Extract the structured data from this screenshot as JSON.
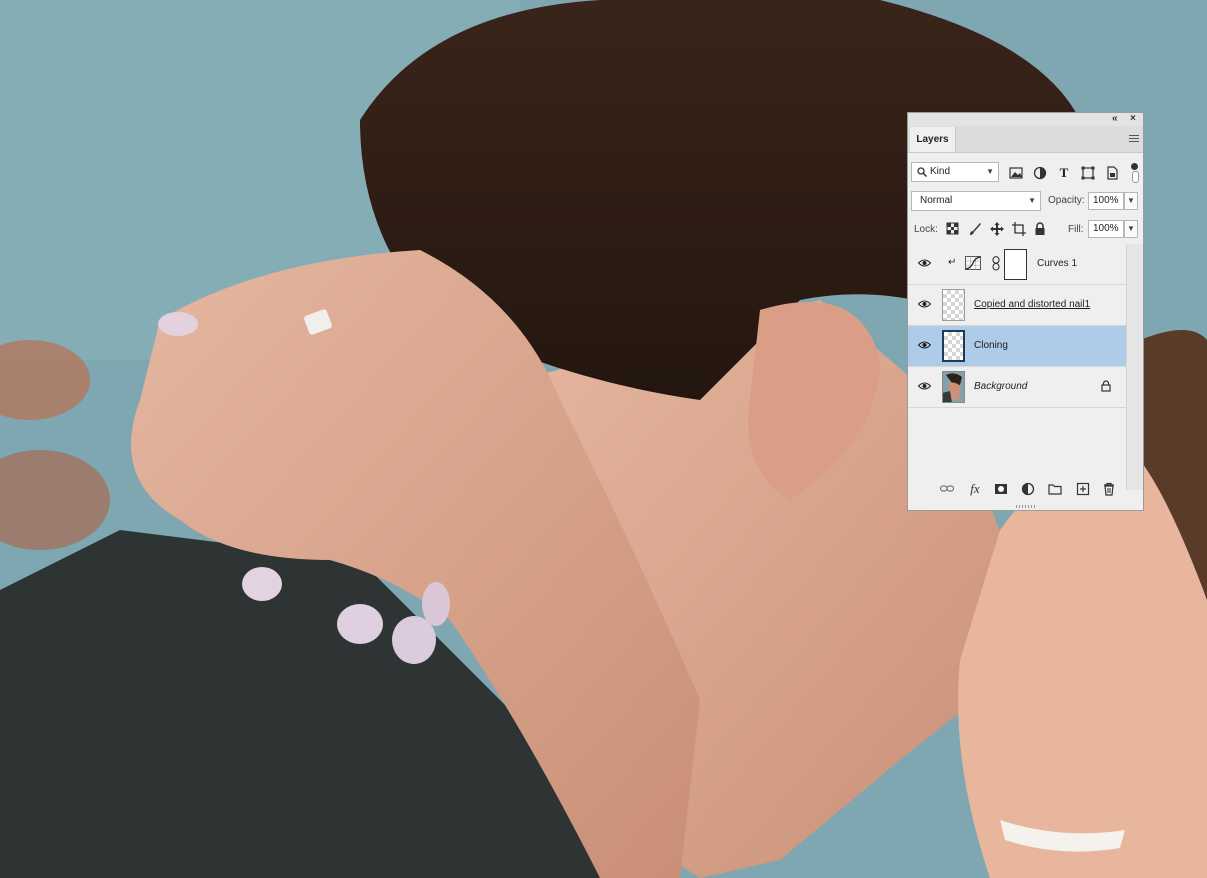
{
  "panel": {
    "title": "Layers",
    "collapse_icon": "double-chevron-left-icon",
    "close_icon": "close-icon",
    "collapse_glyph": "«",
    "close_glyph": "×",
    "filter": {
      "kind_label": "Kind",
      "filter_icons": [
        "image-filter-icon",
        "adjustment-filter-icon",
        "type-filter-icon",
        "shape-filter-icon",
        "smart-object-filter-icon"
      ],
      "type_glyph": "T"
    },
    "blend_mode": "Normal",
    "opacity_label": "Opacity:",
    "opacity_value": "100%",
    "lock_label": "Lock:",
    "fill_label": "Fill:",
    "fill_value": "100%",
    "layers": [
      {
        "name": "Curves 1",
        "type": "adjustment",
        "selected": false,
        "visible": true,
        "clipped": true
      },
      {
        "name": "Copied and distorted nail1",
        "type": "pixel",
        "selected": false,
        "visible": true,
        "clipped": false
      },
      {
        "name": "Cloning",
        "type": "pixel",
        "selected": true,
        "visible": true,
        "clipped": false
      },
      {
        "name": "Background",
        "type": "background",
        "selected": false,
        "visible": true,
        "locked": true
      }
    ],
    "clip_glyph": "↵",
    "bottom_icons": [
      "link-layers-icon",
      "fx-icon",
      "add-mask-icon",
      "new-adjustment-icon",
      "new-group-icon",
      "new-layer-icon",
      "delete-icon"
    ],
    "fx_glyph": "fx"
  },
  "colors": {
    "selected_row": "#aecbe7",
    "panel_bg": "#efefef"
  }
}
